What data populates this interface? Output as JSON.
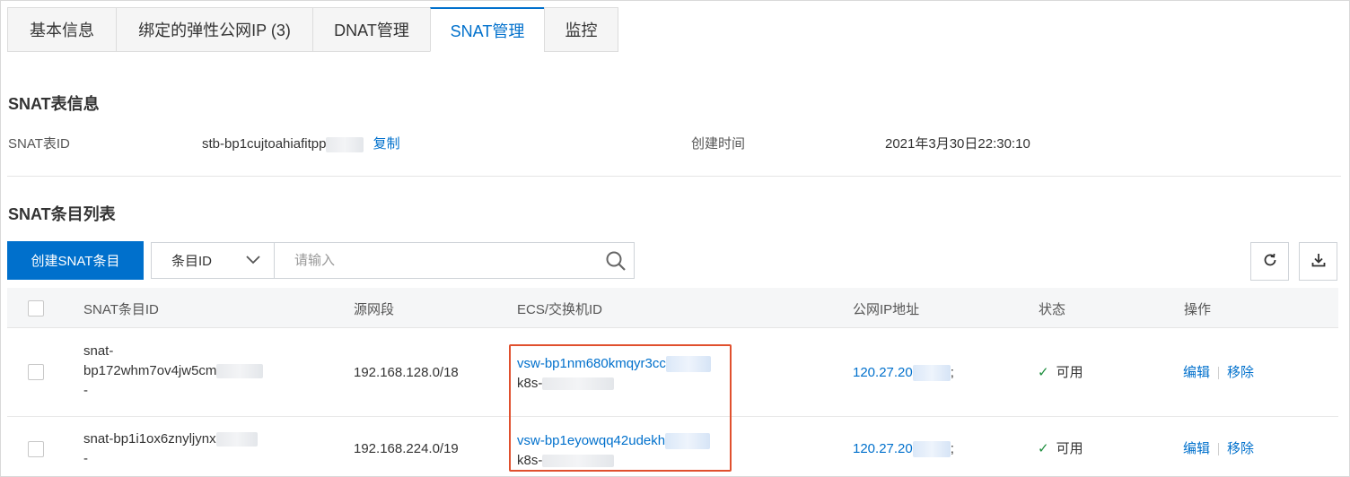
{
  "tabs": [
    {
      "label": "基本信息"
    },
    {
      "label": "绑定的弹性公网IP (3)"
    },
    {
      "label": "DNAT管理"
    },
    {
      "label": "SNAT管理"
    },
    {
      "label": "监控"
    }
  ],
  "active_tab": "SNAT管理",
  "snat_info": {
    "title": "SNAT表信息",
    "id_label": "SNAT表ID",
    "id_value": "stb-bp1cujtoahiafitpp",
    "copy_label": "复制",
    "created_label": "创建时间",
    "created_value": "2021年3月30日22:30:10"
  },
  "entries": {
    "title": "SNAT条目列表",
    "create_button": "创建SNAT条目",
    "filter_select": "条目ID",
    "search_placeholder": "请输入",
    "columns": [
      "SNAT条目ID",
      "源网段",
      "ECS/交换机ID",
      "公网IP地址",
      "状态",
      "操作"
    ],
    "rows": [
      {
        "id_line1": "snat-",
        "id_line2": "bp172whm7ov4jw5cm",
        "id_line3": "-",
        "cidr": "192.168.128.0/18",
        "vsw": "vsw-bp1nm680kmqyr3cc",
        "vsw_name": "k8s-",
        "ip": "120.27.20",
        "ip_suffix": ";",
        "status": "可用",
        "edit": "编辑",
        "remove": "移除"
      },
      {
        "id_line1": "snat-bp1i1ox6znyljynx",
        "id_line2": "-",
        "cidr": "192.168.224.0/19",
        "vsw": "vsw-bp1eyowqq42udekh",
        "vsw_name": "k8s-",
        "ip": "120.27.20",
        "ip_suffix": ";",
        "status": "可用",
        "edit": "编辑",
        "remove": "移除"
      }
    ]
  },
  "colors": {
    "primary": "#0070cc",
    "highlight": "#e0502e",
    "success": "#1e8e3e"
  },
  "icons": [
    "chevron-down-icon",
    "search-icon",
    "refresh-icon",
    "download-icon",
    "check-icon"
  ]
}
